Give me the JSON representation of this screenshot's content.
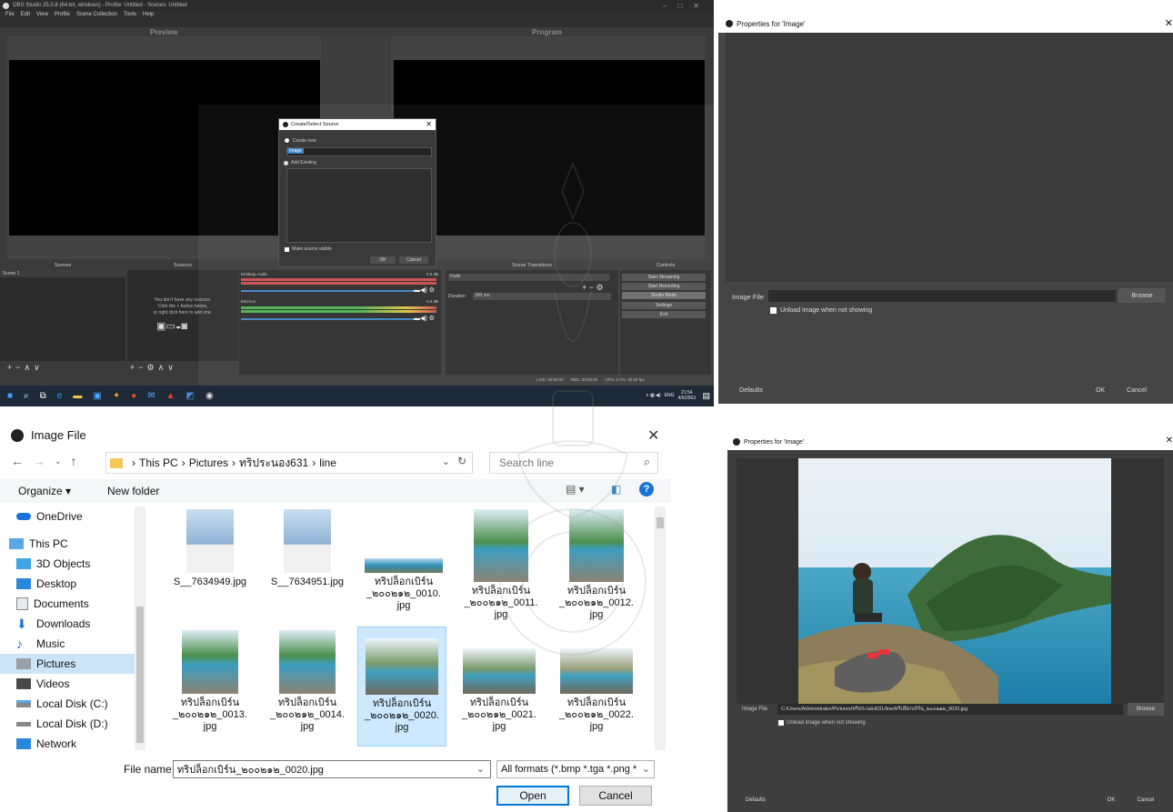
{
  "obs": {
    "title": "OBS Studio 25.0.8 (64-bit, windows) - Profile: Untitled - Scenes: Untitled",
    "menu": [
      "File",
      "Edit",
      "View",
      "Profile",
      "Scene Collection",
      "Tools",
      "Help"
    ],
    "preview_label": "Preview",
    "program_label": "Program",
    "docks": {
      "scenes": "Scenes",
      "sources": "Sources",
      "mixer": "Audio Mixer",
      "transitions": "Scene Transitions",
      "controls": "Controls"
    },
    "scene_item": "Scene 1",
    "no_sources": [
      "You don't have any sources.",
      "Click the + button below,",
      "or right click here to add one."
    ],
    "mixer_channels": [
      {
        "name": "Desktop Audio",
        "db": "0.0 dB"
      },
      {
        "name": "Mic/Aux",
        "db": "0.0 dB"
      }
    ],
    "transition": {
      "value": "Fade",
      "duration_label": "Duration",
      "duration_value": "300 ms"
    },
    "controls": [
      "Start Streaming",
      "Start Recording",
      "Studio Mode",
      "Settings",
      "Exit"
    ],
    "status": {
      "live": "LIVE: 00:00:00",
      "rec": "REC: 00:00:00",
      "cpu": "CPU: 2.7%, 30.00 fps"
    },
    "taskbar": {
      "lang": "ENG",
      "time": "21:54",
      "date": "4/6/2563"
    }
  },
  "create_source": {
    "title": "Create/Select Source",
    "create_new": "Create new",
    "name_value": "Image",
    "add_existing": "Add Existing",
    "make_visible": "Make source visible",
    "ok": "OK",
    "cancel": "Cancel"
  },
  "props_top": {
    "title": "Properties for 'Image'",
    "image_file_label": "Image File",
    "image_file_value": "",
    "browse": "Browse",
    "unload": "Unload image when not showing",
    "defaults": "Defaults",
    "ok": "OK",
    "cancel": "Cancel"
  },
  "file_dialog": {
    "title": "Image File",
    "breadcrumb": [
      "This PC",
      "Pictures",
      "ทริประนอง631",
      "line"
    ],
    "search_placeholder": "Search line",
    "organize": "Organize ▾",
    "new_folder": "New folder",
    "sidebar": [
      {
        "label": "OneDrive",
        "icon": "cloud-icon"
      },
      {
        "label": "This PC",
        "icon": "computer-icon"
      },
      {
        "label": "3D Objects",
        "icon": "cube-icon"
      },
      {
        "label": "Desktop",
        "icon": "desktop-icon"
      },
      {
        "label": "Documents",
        "icon": "document-icon"
      },
      {
        "label": "Downloads",
        "icon": "download-icon"
      },
      {
        "label": "Music",
        "icon": "music-icon"
      },
      {
        "label": "Pictures",
        "icon": "pictures-icon"
      },
      {
        "label": "Videos",
        "icon": "video-icon"
      },
      {
        "label": "Local Disk (C:)",
        "icon": "drive-icon"
      },
      {
        "label": "Local Disk (D:)",
        "icon": "drive-icon"
      },
      {
        "label": "Network",
        "icon": "network-icon"
      }
    ],
    "files": [
      {
        "name": "S__7634949.jpg"
      },
      {
        "name": "S__7634951.jpg"
      },
      {
        "name": "ทริปล็อกเบิร์น_๒๐๐๒๑๒_0010.jpg"
      },
      {
        "name": "ทริปล็อกเบิร์น_๒๐๐๒๑๒_0011.jpg"
      },
      {
        "name": "ทริปล็อกเบิร์น_๒๐๐๒๑๒_0012.jpg"
      },
      {
        "name": "ทริปล็อกเบิร์น_๒๐๐๒๑๒_0013.jpg"
      },
      {
        "name": "ทริปล็อกเบิร์น_๒๐๐๒๑๒_0014.jpg"
      },
      {
        "name": "ทริปล็อกเบิร์น_๒๐๐๒๑๒_0020.jpg"
      },
      {
        "name": "ทริปล็อกเบิร์น_๒๐๐๒๑๒_0021.jpg"
      },
      {
        "name": "ทริปล็อกเบิร์น_๒๐๐๒๑๒_0022.jpg"
      }
    ],
    "file_lines": [
      [
        "S__7634949.jpg"
      ],
      [
        "S__7634951.jpg"
      ],
      [
        "ทริปล็อกเบิร์น",
        "_๒๐๐๒๑๒_0010.",
        "jpg"
      ],
      [
        "ทริปล็อกเบิร์น",
        "_๒๐๐๒๑๒_0011.",
        "jpg"
      ],
      [
        "ทริปล็อกเบิร์น",
        "_๒๐๐๒๑๒_0012.",
        "jpg"
      ],
      [
        "ทริปล็อกเบิร์น",
        "_๒๐๐๒๑๒_0013.",
        "jpg"
      ],
      [
        "ทริปล็อกเบิร์น",
        "_๒๐๐๒๑๒_0014.",
        "jpg"
      ],
      [
        "ทริปล็อกเบิร์น",
        "_๒๐๐๒๑๒_0020.",
        "jpg"
      ],
      [
        "ทริปล็อกเบิร์น",
        "_๒๐๐๒๑๒_0021.",
        "jpg"
      ],
      [
        "ทริปล็อกเบิร์น",
        "_๒๐๐๒๑๒_0022.",
        "jpg"
      ]
    ],
    "file_name_label": "File name:",
    "file_name_value": "ทริปล็อกเบิร์น_๒๐๐๒๑๒_0020.jpg",
    "filter": "All formats (*.bmp *.tga *.png *",
    "open": "Open",
    "cancel": "Cancel"
  },
  "props_bottom": {
    "title": "Properties for 'Image'",
    "image_file_label": "Image File",
    "image_file_value": "C:/Users/Administrator/Pictures/ทริประนอง631/line/ทริปล็อกเบิร์น_๒๐๐๒๑๒_0020.jpg",
    "browse": "Browse",
    "unload": "Unload image when not showing",
    "defaults": "Defaults",
    "ok": "OK",
    "cancel": "Cancel"
  },
  "colors": {
    "obs_bg": "#3b3b3b",
    "obs_dark": "#2b2b2b",
    "accent_blue": "#3b82c4",
    "meter_red": "#c94c4c",
    "meter_green": "#4caf50",
    "win_select": "#cde8ff",
    "win_link": "#0066cc"
  }
}
